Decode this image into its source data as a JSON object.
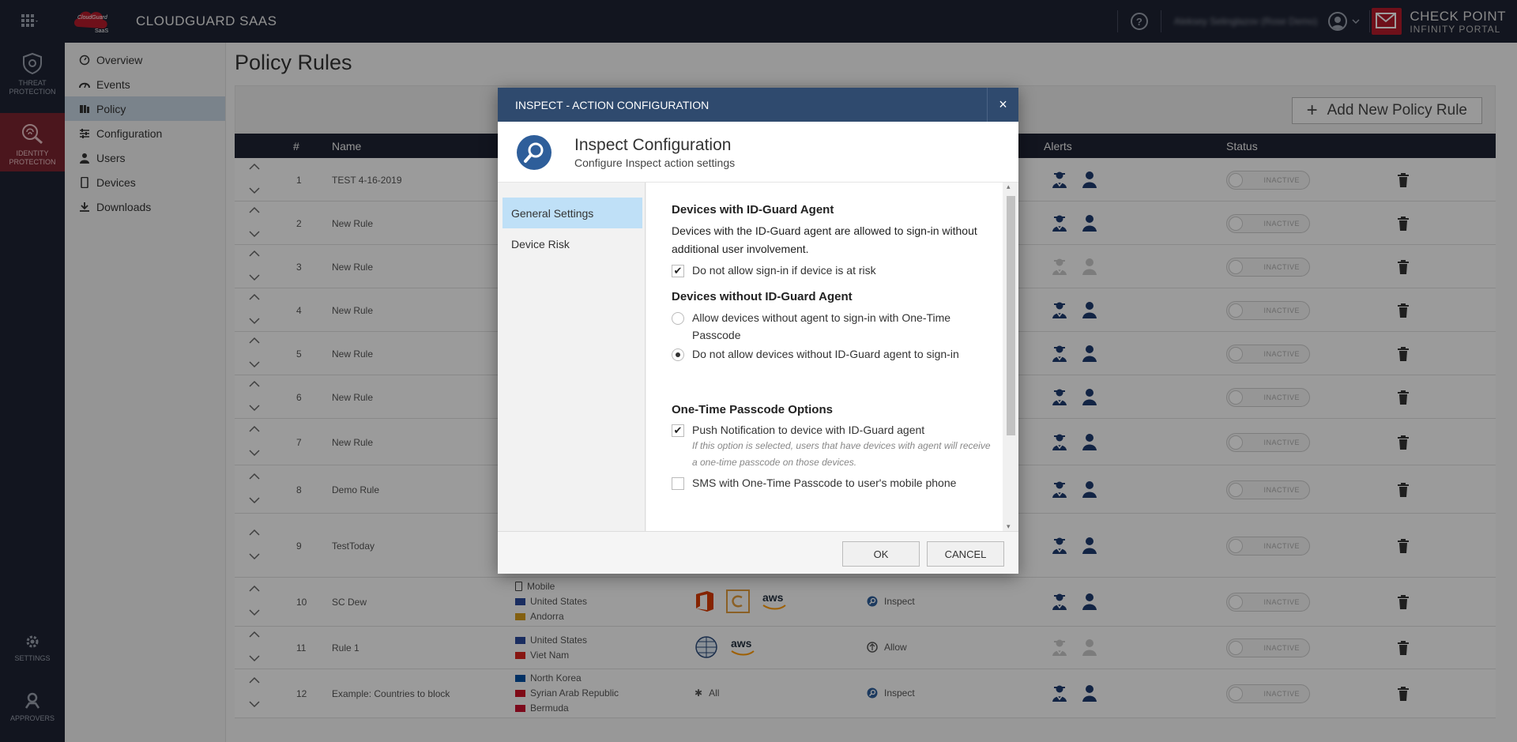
{
  "topbar": {
    "app_title": "CLOUDGUARD SAAS",
    "logo_top": "CloudGuard",
    "logo_bottom": "SaaS",
    "help_glyph": "?",
    "user_name": "Aleksey Selinglazov (Rose Demo)",
    "brand_line1": "CHECK POINT",
    "brand_line2": "INFINITY PORTAL"
  },
  "rail": {
    "threat_protection": "THREAT PROTECTION",
    "identity_protection": "IDENTITY PROTECTION",
    "settings": "SETTINGS",
    "approvers": "APPROVERS"
  },
  "subnav": {
    "items": [
      {
        "label": "Overview",
        "icon": "overview-icon"
      },
      {
        "label": "Events",
        "icon": "events-icon"
      },
      {
        "label": "Policy",
        "icon": "policy-icon"
      },
      {
        "label": "Configuration",
        "icon": "configuration-icon"
      },
      {
        "label": "Users",
        "icon": "user-icon"
      },
      {
        "label": "Devices",
        "icon": "device-icon"
      },
      {
        "label": "Downloads",
        "icon": "download-icon"
      }
    ],
    "active": "Policy"
  },
  "main": {
    "title": "Policy Rules",
    "add_button": "Add New Policy Rule",
    "columns": {
      "num": "#",
      "name": "Name",
      "alerts": "Alerts",
      "status": "Status"
    },
    "status_text": "INACTIVE",
    "rows": [
      {
        "num": "1",
        "name": "TEST 4-16-2019"
      },
      {
        "num": "2",
        "name": "New Rule"
      },
      {
        "num": "3",
        "name": "New Rule"
      },
      {
        "num": "4",
        "name": "New Rule"
      },
      {
        "num": "5",
        "name": "New Rule"
      },
      {
        "num": "6",
        "name": "New Rule"
      },
      {
        "num": "7",
        "name": "New Rule"
      },
      {
        "num": "8",
        "name": "Demo Rule"
      },
      {
        "num": "9",
        "name": "TestToday"
      },
      {
        "num": "10",
        "name": "SC Dew",
        "locations": [
          "Mobile",
          "United States",
          "Andorra"
        ],
        "apps": [
          "office-icon",
          "c-icon",
          "aws"
        ],
        "action": "Inspect"
      },
      {
        "num": "11",
        "name": "Rule 1",
        "locations": [
          "United States",
          "Viet Nam"
        ],
        "apps": [
          "globe-icon",
          "aws"
        ],
        "action": "Allow"
      },
      {
        "num": "12",
        "name": "Example: Countries to block",
        "locations": [
          "North Korea",
          "Syrian Arab Republic",
          "Bermuda"
        ],
        "apps_text": "All",
        "action": "Inspect"
      }
    ]
  },
  "modal": {
    "header": "INSPECT - ACTION CONFIGURATION",
    "close": "×",
    "title": "Inspect Configuration",
    "subtitle": "Configure Inspect action settings",
    "nav": [
      "General Settings",
      "Device Risk"
    ],
    "sec1_title": "Devices with ID-Guard Agent",
    "sec1_text": "Devices with the ID-Guard agent are allowed to sign-in without additional user involvement.",
    "sec1_opt": "Do not allow sign-in if device is at risk",
    "sec2_title": "Devices without ID-Guard Agent",
    "sec2_opt1": "Allow devices without agent to sign-in with One-Time Passcode",
    "sec2_opt2": "Do not allow devices without ID-Guard agent to sign-in",
    "sec3_title": "One-Time Passcode Options",
    "sec3_opt1": "Push Notification to device with ID-Guard agent",
    "sec3_hint": "If this option is selected, users that have devices with agent will receive a one-time passcode on those devices.",
    "sec3_opt2": "SMS with One-Time Passcode to user's mobile phone",
    "ok": "OK",
    "cancel": "CANCEL",
    "check": "✔",
    "scroll_up": "▴",
    "scroll_down": "▾"
  }
}
